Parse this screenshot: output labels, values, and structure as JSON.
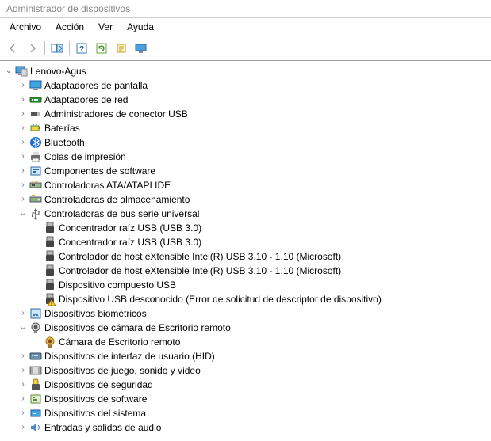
{
  "window": {
    "title": "Administrador de dispositivos"
  },
  "menu": {
    "archivo": "Archivo",
    "accion": "Acción",
    "ver": "Ver",
    "ayuda": "Ayuda"
  },
  "toolbar": {
    "back": "back",
    "forward": "forward",
    "up": "up",
    "show": "show",
    "help": "help",
    "refresh": "refresh",
    "props": "properties",
    "monitor": "monitor"
  },
  "tree": {
    "root": "Lenovo-Agus",
    "items": [
      {
        "label": "Adaptadores de pantalla",
        "icon": "display",
        "arrow": "right"
      },
      {
        "label": "Adaptadores de red",
        "icon": "network",
        "arrow": "right"
      },
      {
        "label": "Administradores de conector USB",
        "icon": "usb-connector",
        "arrow": "right"
      },
      {
        "label": "Baterías",
        "icon": "battery",
        "arrow": "right"
      },
      {
        "label": "Bluetooth",
        "icon": "bluetooth",
        "arrow": "right"
      },
      {
        "label": "Colas de impresión",
        "icon": "printer",
        "arrow": "right"
      },
      {
        "label": "Componentes de software",
        "icon": "software",
        "arrow": "right"
      },
      {
        "label": "Controladoras ATA/ATAPI IDE",
        "icon": "ide",
        "arrow": "right"
      },
      {
        "label": "Controladoras de almacenamiento",
        "icon": "storage",
        "arrow": "right"
      },
      {
        "label": "Controladoras de bus serie universal",
        "icon": "usb",
        "arrow": "down",
        "children": [
          {
            "label": "Concentrador raíz USB (USB 3.0)",
            "icon": "usb-plug"
          },
          {
            "label": "Concentrador raíz USB (USB 3.0)",
            "icon": "usb-plug"
          },
          {
            "label": "Controlador de host eXtensible Intel(R) USB 3.10 - 1.10 (Microsoft)",
            "icon": "usb-plug"
          },
          {
            "label": "Controlador de host eXtensible Intel(R) USB 3.10 - 1.10 (Microsoft)",
            "icon": "usb-plug"
          },
          {
            "label": "Dispositivo compuesto USB",
            "icon": "usb-plug"
          },
          {
            "label": "Dispositivo USB desconocido (Error de solicitud de descriptor de dispositivo)",
            "icon": "usb-warn"
          }
        ]
      },
      {
        "label": "Dispositivos biométricos",
        "icon": "biometric",
        "arrow": "right"
      },
      {
        "label": "Dispositivos de cámara de Escritorio remoto",
        "icon": "camera",
        "arrow": "down",
        "children": [
          {
            "label": "Cámara de Escritorio remoto",
            "icon": "camera-child"
          }
        ]
      },
      {
        "label": "Dispositivos de interfaz de usuario (HID)",
        "icon": "hid",
        "arrow": "right"
      },
      {
        "label": "Dispositivos de juego, sonido y video",
        "icon": "media",
        "arrow": "right"
      },
      {
        "label": "Dispositivos de seguridad",
        "icon": "security",
        "arrow": "right"
      },
      {
        "label": "Dispositivos de software",
        "icon": "soft-device",
        "arrow": "right"
      },
      {
        "label": "Dispositivos del sistema",
        "icon": "system",
        "arrow": "right"
      },
      {
        "label": "Entradas y salidas de audio",
        "icon": "audio",
        "arrow": "right"
      }
    ]
  }
}
